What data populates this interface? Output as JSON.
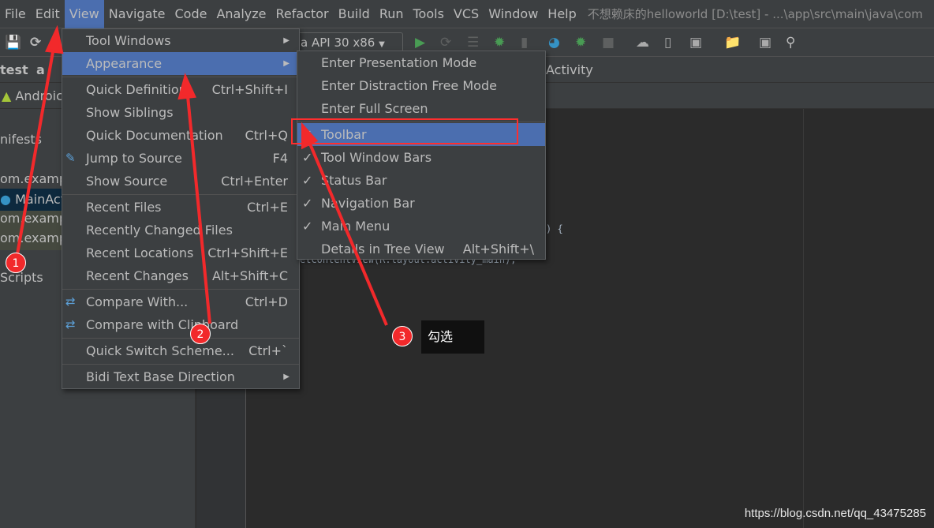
{
  "menubar": {
    "items": [
      "File",
      "Edit",
      "View",
      "Navigate",
      "Code",
      "Analyze",
      "Refactor",
      "Build",
      "Run",
      "Tools",
      "VCS",
      "Window",
      "Help"
    ],
    "active": "View",
    "title": "不想赖床的helloworld [D:\\test] - ...\\app\\src\\main\\java\\com"
  },
  "toolbar": {
    "device": "a API 30 x86",
    "icons": [
      "save-icon",
      "sync-icon",
      "run-icon",
      "apply-changes-icon",
      "apply-code-changes-icon",
      "debug-icon",
      "attach-icon",
      "profile-icon",
      "attach-debugger-icon",
      "stop-icon",
      "gradle-sync-icon",
      "avd-manager-icon",
      "sdk-manager-icon",
      "project-structure-icon",
      "terminal-icon",
      "search-icon"
    ]
  },
  "navbar": {
    "project": "test",
    "folder": "a",
    "file": "Activity"
  },
  "leftpanel": {
    "items": [
      "Androic",
      "nifests",
      "om.examp",
      "MainAct",
      "om.examp",
      "om.examp",
      "Scripts"
    ]
  },
  "editor": {
    "lines": [
      ") {",
      "etContentView(R.layout.activity_main);"
    ]
  },
  "view_menu": {
    "items": [
      {
        "label": "Tool Windows",
        "submenu": true
      },
      {
        "label": "Appearance",
        "submenu": true,
        "selected": true
      },
      {
        "label": "Quick Definition",
        "shortcut": "Ctrl+Shift+I"
      },
      {
        "label": "Show Siblings"
      },
      {
        "label": "Quick Documentation",
        "shortcut": "Ctrl+Q"
      },
      {
        "label": "Jump to Source",
        "shortcut": "F4",
        "icon": "pencil-icon"
      },
      {
        "label": "Show Source",
        "shortcut": "Ctrl+Enter"
      },
      {
        "label": "Recent Files",
        "shortcut": "Ctrl+E"
      },
      {
        "label": "Recently Changed Files"
      },
      {
        "label": "Recent Locations",
        "shortcut": "Ctrl+Shift+E"
      },
      {
        "label": "Recent Changes",
        "shortcut": "Alt+Shift+C"
      },
      {
        "label": "Compare With...",
        "shortcut": "Ctrl+D",
        "icon": "compare-icon"
      },
      {
        "label": "Compare with Clipboard",
        "icon": "compare-clipboard-icon"
      },
      {
        "label": "Quick Switch Scheme...",
        "shortcut": "Ctrl+`"
      },
      {
        "label": "Bidi Text Base Direction",
        "submenu": true
      }
    ]
  },
  "appearance_menu": {
    "items": [
      {
        "label": "Enter Presentation Mode"
      },
      {
        "label": "Enter Distraction Free Mode"
      },
      {
        "label": "Enter Full Screen"
      },
      {
        "label": "Toolbar",
        "checked": true,
        "selected": true
      },
      {
        "label": "Tool Window Bars",
        "checked": true
      },
      {
        "label": "Status Bar",
        "checked": true
      },
      {
        "label": "Navigation Bar",
        "checked": true
      },
      {
        "label": "Main Menu",
        "checked": true
      },
      {
        "label": "Details in Tree View",
        "shortcut": "Alt+Shift+\\"
      }
    ]
  },
  "annotations": {
    "steps": [
      "1",
      "2",
      "3"
    ],
    "tip": "勾选",
    "color": "#f2292b"
  },
  "watermark": "https://blog.csdn.net/qq_43475285"
}
